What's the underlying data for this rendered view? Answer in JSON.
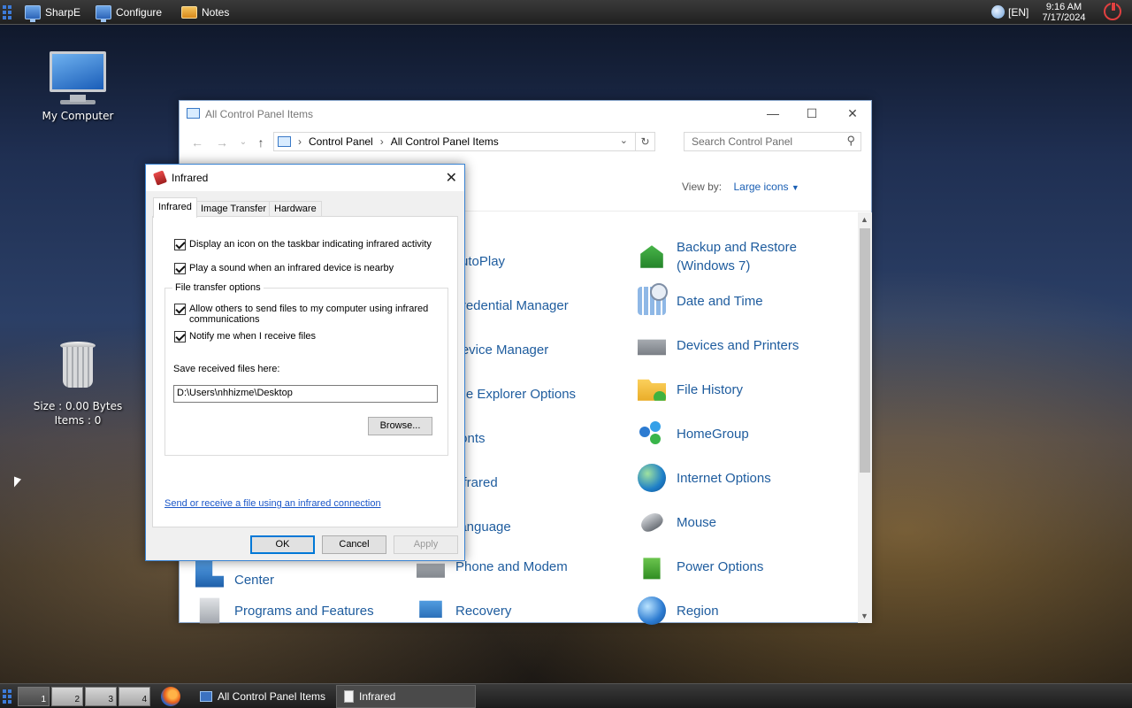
{
  "topbar": {
    "items": [
      {
        "label": "SharpE"
      },
      {
        "label": "Configure"
      },
      {
        "label": "Notes"
      }
    ],
    "language": "[EN]",
    "time": "9:16 AM",
    "date": "7/17/2024"
  },
  "desktop": {
    "my_computer": "My Computer",
    "trash_size": "Size : 0.00 Bytes",
    "trash_items": "Items : 0"
  },
  "control_panel": {
    "title": "All Control Panel Items",
    "breadcrumb": [
      "Control Panel",
      "All Control Panel Items"
    ],
    "search_placeholder": "Search Control Panel",
    "view_by_label": "View by:",
    "view_by_value": "Large icons",
    "col2": [
      {
        "label": "AutoPlay"
      },
      {
        "label": "Credential Manager"
      },
      {
        "label": "Device Manager"
      },
      {
        "label": "File Explorer Options"
      },
      {
        "label": "Fonts"
      },
      {
        "label": "Infrared"
      },
      {
        "label": "Language"
      },
      {
        "label": "Phone and Modem"
      },
      {
        "label": "Recovery"
      }
    ],
    "col3": [
      {
        "label": "Backup and Restore (Windows 7)",
        "icon": "backup-restore-icon"
      },
      {
        "label": "Date and Time",
        "icon": "date-time-icon"
      },
      {
        "label": "Devices and Printers",
        "icon": "printer-icon"
      },
      {
        "label": "File History",
        "icon": "file-history-icon"
      },
      {
        "label": "HomeGroup",
        "icon": "homegroup-icon"
      },
      {
        "label": "Internet Options",
        "icon": "internet-options-icon"
      },
      {
        "label": "Mouse",
        "icon": "mouse-icon"
      },
      {
        "label": "Power Options",
        "icon": "power-options-icon"
      },
      {
        "label": "Region",
        "icon": "region-icon"
      }
    ],
    "col1_partial": [
      {
        "label": "Center"
      },
      {
        "label": "Programs and Features"
      }
    ]
  },
  "infrared_dialog": {
    "title": "Infrared",
    "tabs": [
      "Infrared",
      "Image Transfer",
      "Hardware"
    ],
    "options": {
      "taskbar_icon": "Display an icon on the taskbar indicating infrared activity",
      "play_sound": "Play a sound when an infrared device is nearby"
    },
    "file_transfer": {
      "group_label": "File transfer options",
      "allow_others": "Allow others to send files to my computer using infrared communications",
      "notify": "Notify me when I receive files",
      "save_label": "Save received files here:",
      "save_path": "D:\\Users\\nhhizme\\Desktop",
      "browse": "Browse..."
    },
    "link": "Send or receive a file using an infrared connection",
    "buttons": {
      "ok": "OK",
      "cancel": "Cancel",
      "apply": "Apply"
    }
  },
  "taskbar": {
    "workspaces": [
      "1",
      "2",
      "3",
      "4"
    ],
    "tasks": [
      {
        "label": "All Control Panel Items"
      },
      {
        "label": "Infrared"
      }
    ]
  }
}
